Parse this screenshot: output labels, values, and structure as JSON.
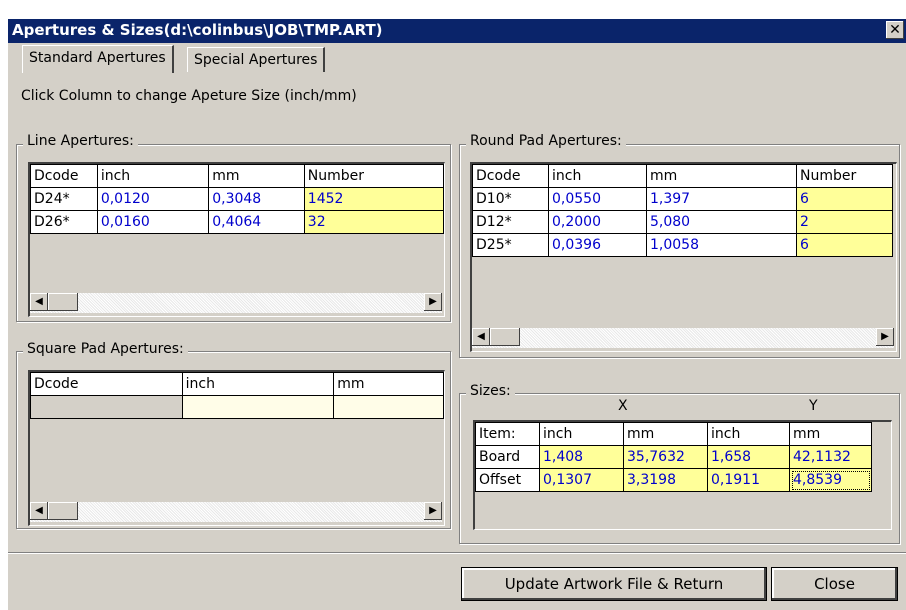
{
  "window": {
    "title": "Apertures & Sizes(d:\\colinbus\\JOB\\TMP.ART)",
    "close_glyph": "✕"
  },
  "tabs": [
    {
      "label": "Standard Apertures",
      "selected": true
    },
    {
      "label": "Special Apertures",
      "selected": false
    }
  ],
  "instruction": "Click Column to change Apeture Size (inch/mm)",
  "line_apertures": {
    "label": "Line Apertures:",
    "columns": [
      "Dcode",
      "inch",
      "mm",
      "Number"
    ],
    "rows": [
      {
        "dcode": "D24*",
        "inch": "0,0120",
        "mm": "0,3048",
        "number": "1452"
      },
      {
        "dcode": "D26*",
        "inch": "0,0160",
        "mm": "0,4064",
        "number": "32"
      }
    ]
  },
  "round_pad_apertures": {
    "label": "Round Pad Apertures:",
    "columns": [
      "Dcode",
      "inch",
      "mm",
      "Number"
    ],
    "rows": [
      {
        "dcode": "D10*",
        "inch": "0,0550",
        "mm": "1,397",
        "number": "6"
      },
      {
        "dcode": "D12*",
        "inch": "0,2000",
        "mm": "5,080",
        "number": "2"
      },
      {
        "dcode": "D25*",
        "inch": "0,0396",
        "mm": "1,0058",
        "number": "6"
      }
    ]
  },
  "square_pad_apertures": {
    "label": "Square Pad Apertures:",
    "columns": [
      "Dcode",
      "inch",
      "mm"
    ]
  },
  "sizes": {
    "label": "Sizes:",
    "x_label": "X",
    "y_label": "Y",
    "columns": [
      "Item:",
      "inch",
      "mm",
      "inch",
      "mm"
    ],
    "rows": [
      {
        "item": "Board",
        "x_inch": "1,408",
        "x_mm": "35,7632",
        "y_inch": "1,658",
        "y_mm": "42,1132"
      },
      {
        "item": "Offset",
        "x_inch": "0,1307",
        "x_mm": "3,3198",
        "y_inch": "0,1911",
        "y_mm": "4,8539"
      }
    ]
  },
  "buttons": {
    "update": "Update Artwork File & Return",
    "close": "Close"
  },
  "scroll": {
    "left": "◀",
    "right": "▶"
  }
}
